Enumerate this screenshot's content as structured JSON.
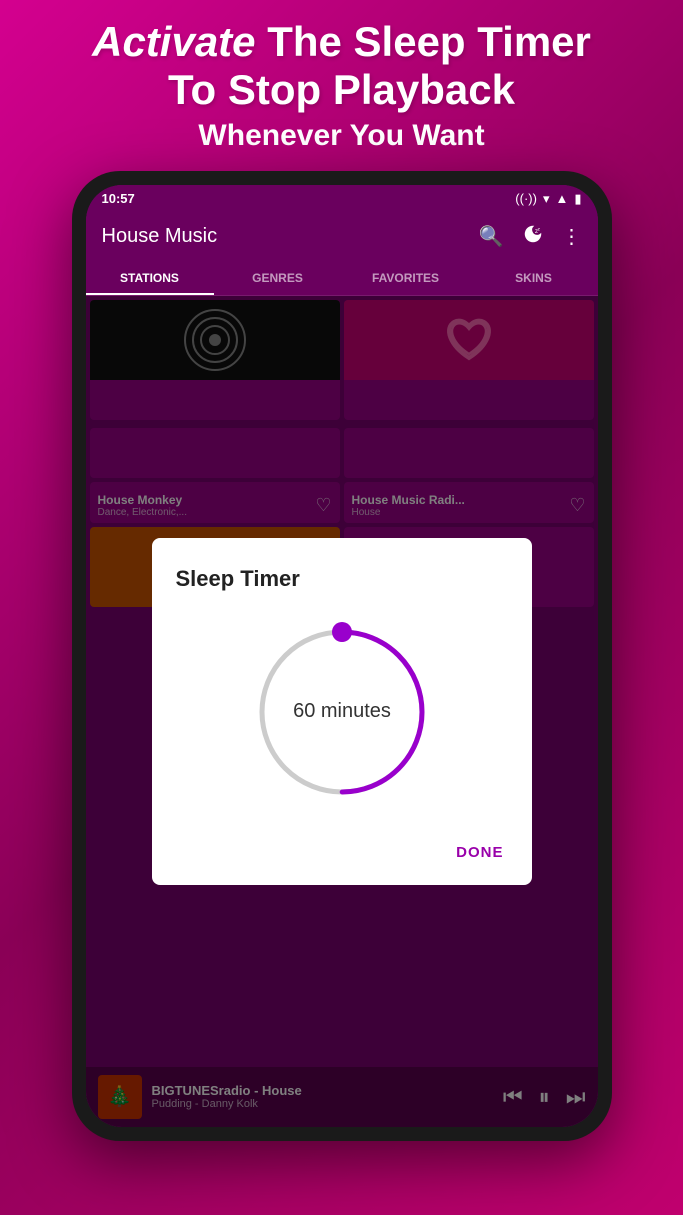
{
  "promo": {
    "line1a": "Activate",
    "line1b": "The Sleep Timer",
    "line2a": "To",
    "line2b": "Stop Playback",
    "line3": "Whenever You Want"
  },
  "statusBar": {
    "time": "10:57",
    "icons": [
      "radio",
      "wifi",
      "signal",
      "battery"
    ]
  },
  "appHeader": {
    "title": "House Music",
    "searchIcon": "🔍",
    "sleepIcon": "😴",
    "moreIcon": "⋮"
  },
  "tabs": [
    {
      "label": "STATIONS",
      "active": true
    },
    {
      "label": "GENRES",
      "active": false
    },
    {
      "label": "FAVORITES",
      "active": false
    },
    {
      "label": "SKINS",
      "active": false
    }
  ],
  "sleepTimerDialog": {
    "title": "Sleep Timer",
    "minutes": "60 minutes",
    "doneLabel": "DONE"
  },
  "stations": [
    {
      "name": "House Monkey",
      "genre": "Dance, Electronic,...",
      "hasFav": true
    },
    {
      "name": "House Music Radi...",
      "genre": "House",
      "hasFav": true
    }
  ],
  "bottomPlayer": {
    "thumbnail": "🎄",
    "station": "BIGTUNESradio - House",
    "track": "Pudding - Danny Kolk",
    "prevIcon": "⏮",
    "pauseIcon": "⏸",
    "nextIcon": "⏭"
  }
}
